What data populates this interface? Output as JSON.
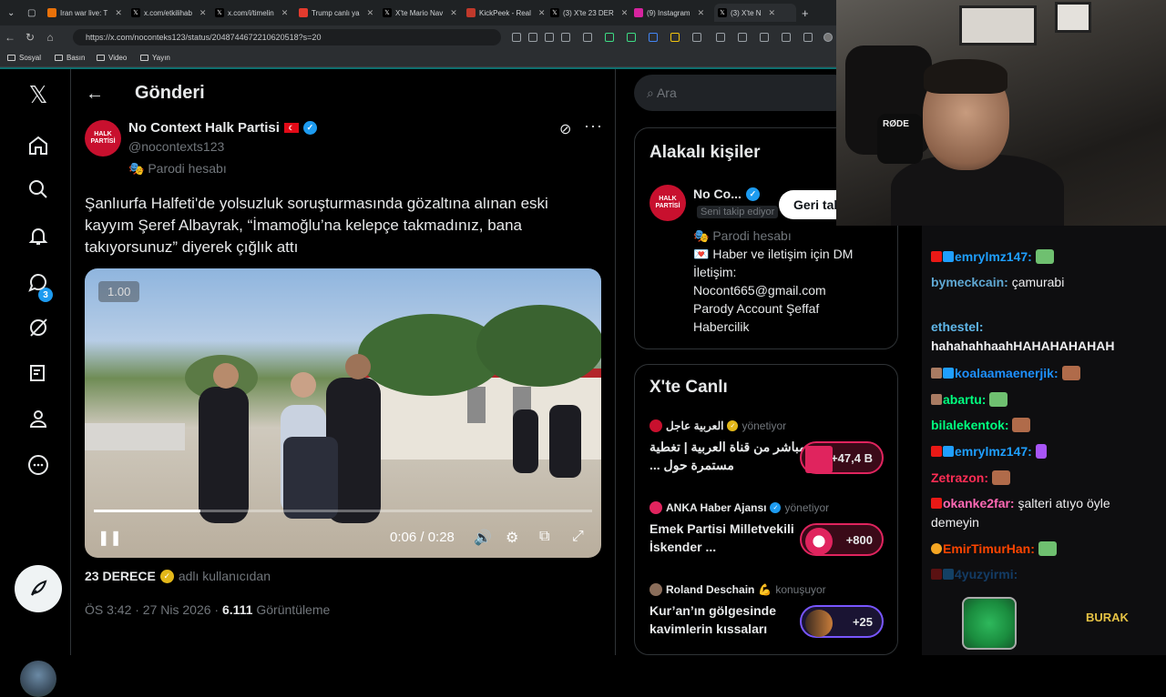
{
  "browser": {
    "tabs": [
      {
        "title": "Iran war live: T",
        "icon_color": "#e8710a"
      },
      {
        "title": "x.com/etkilihab",
        "icon_color": "#000000"
      },
      {
        "title": "x.com/i/timelin",
        "icon_color": "#000000"
      },
      {
        "title": "Trump canlı ya",
        "icon_color": "#e33b2e"
      },
      {
        "title": "X'te Mario Nav",
        "icon_color": "#000000"
      },
      {
        "title": "KickPeek - Real",
        "icon_color": "#c0392b"
      },
      {
        "title": "(3) X'te 23 DER",
        "icon_color": "#000000"
      },
      {
        "title": "(9) Instagram",
        "icon_color": "#d6249f"
      },
      {
        "title": "(3) X'te N",
        "icon_color": "#000000"
      }
    ],
    "url": "https://x.com/noconteks123/status/2048744672210620518?s=20",
    "bookmarks": [
      "Sosyal",
      "Basın",
      "Video",
      "Yayın"
    ]
  },
  "nav": {
    "notifications_count": "3"
  },
  "header": {
    "title": "Gönderi"
  },
  "post": {
    "author_name": "No Context Halk Partisi",
    "author_flag": "TR",
    "author_handle": "@nocontexts123",
    "label": "Parodi hesabı",
    "avatar_text_1": "HALK",
    "avatar_text_2": "PARTİSİ",
    "text": "Şanlıurfa Halfeti'de yolsuzluk soruşturmasında gözaltına alınan eski kayyım Şeref Albayrak, “İmamoğlu’na kelepçe takmadınız, bana takıyorsunuz” diyerek çığlık attı",
    "video": {
      "speed": "1.00",
      "time": "0:06 / 0:28",
      "progress_fraction": 0.214
    },
    "source_name": "23 DERECE",
    "source_suffix": "adlı kullanıcıdan",
    "time": "ÖS 3:42 · 27 Nis 2026 ·",
    "views": "6.111",
    "views_label": "Görüntüleme"
  },
  "sidebar": {
    "search_placeholder": "Ara",
    "related_title": "Alakalı kişiler",
    "related_person": {
      "name": "No Co...",
      "follows_you": "Seni takip ediyor",
      "button": "Geri tak",
      "bio_label": "Parodi hesabı",
      "bio_lines": [
        "Haber ve iletişim için DM",
        "İletişim:",
        "Nocont665@gmail.com",
        "Parody Account Şeffaf",
        "Habercilik"
      ]
    },
    "live_title": "X'te Canlı",
    "live_items": [
      {
        "host": "العربية عاجل",
        "role": "yönetiyor",
        "title": "مباشر من قناة العربية | تغطية مستمرة حول ...",
        "count": "+47,4 B",
        "accent": "#e0245e"
      },
      {
        "host": "ANKA Haber Ajansı",
        "role": "yönetiyor",
        "title": "Emek Partisi Milletvekili İskender ...",
        "count": "+800",
        "accent": "#e0245e"
      },
      {
        "host": "Roland Deschain",
        "role": "konuşuyor",
        "title": "Kur’an’ın gölgesinde kavimlerin kıssaları",
        "count": "+25",
        "accent": "#7856ff"
      }
    ]
  },
  "chat": {
    "messages": [
      {
        "user": "emrylmz147:",
        "text": "",
        "color": "#1f9fff"
      },
      {
        "user": "bymeckcain:",
        "text": "çamurabi",
        "color": "#5f9ea0"
      },
      {
        "user": "ethestel:",
        "text": "hahahahhaahHAHAHAHAHAH",
        "color": "#5fb6e8"
      },
      {
        "user": "koalaamaenerjik:",
        "text": "",
        "color": "#1e90ff"
      },
      {
        "user": "abartu:",
        "text": "",
        "color": "#00ff7f"
      },
      {
        "user": "bilalekentok:",
        "text": "",
        "color": "#00ff7f"
      },
      {
        "user": "emrylmz147:",
        "text": "",
        "color": "#1f9fff"
      },
      {
        "user": "Zetrazon:",
        "text": "",
        "color": "#ff2d55"
      },
      {
        "user": "okanke2far:",
        "text": "şalteri atıyo öyle demeyin",
        "color": "#ff69b4"
      },
      {
        "user": "EmirTimurHan:",
        "text": "",
        "color": "#ff4500"
      },
      {
        "user": "4yuzyirmi:",
        "text": "",
        "color": "#1e90ff"
      }
    ],
    "overlay_name": "BURAK"
  },
  "webcam": {
    "mic_brand": "RØDE"
  },
  "colors": {
    "accent": "#1d9bf0",
    "background": "#000000"
  }
}
